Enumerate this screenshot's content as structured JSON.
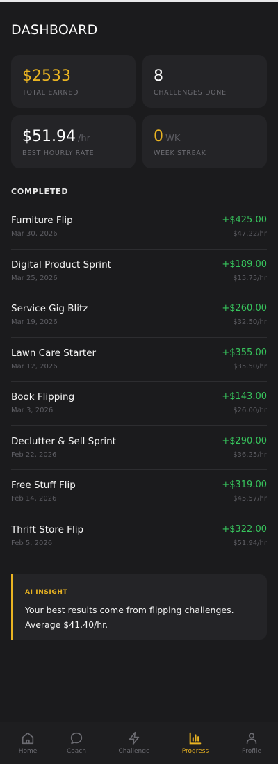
{
  "header": {
    "title": "DASHBOARD"
  },
  "stats": {
    "total_earned": {
      "value": "$2533",
      "label": "TOTAL EARNED"
    },
    "challenges_done": {
      "value": "8",
      "label": "CHALLENGES DONE"
    },
    "best_hourly_rate": {
      "value": "$51.94",
      "unit": "/hr",
      "label": "BEST HOURLY RATE"
    },
    "week_streak": {
      "value": "0",
      "unit": "WK",
      "label": "WEEK STREAK"
    }
  },
  "completed": {
    "title": "COMPLETED",
    "items": [
      {
        "name": "Furniture Flip",
        "date": "Mar 30, 2026",
        "amount": "+$425.00",
        "rate": "$47.22/hr"
      },
      {
        "name": "Digital Product Sprint",
        "date": "Mar 25, 2026",
        "amount": "+$189.00",
        "rate": "$15.75/hr"
      },
      {
        "name": "Service Gig Blitz",
        "date": "Mar 19, 2026",
        "amount": "+$260.00",
        "rate": "$32.50/hr"
      },
      {
        "name": "Lawn Care Starter",
        "date": "Mar 12, 2026",
        "amount": "+$355.00",
        "rate": "$35.50/hr"
      },
      {
        "name": "Book Flipping",
        "date": "Mar 3, 2026",
        "amount": "+$143.00",
        "rate": "$26.00/hr"
      },
      {
        "name": "Declutter & Sell Sprint",
        "date": "Feb 22, 2026",
        "amount": "+$290.00",
        "rate": "$36.25/hr"
      },
      {
        "name": "Free Stuff Flip",
        "date": "Feb 14, 2026",
        "amount": "+$319.00",
        "rate": "$45.57/hr"
      },
      {
        "name": "Thrift Store Flip",
        "date": "Feb 5, 2026",
        "amount": "+$322.00",
        "rate": "$51.94/hr"
      }
    ]
  },
  "insight": {
    "tag": "AI INSIGHT",
    "text": "Your best results come from flipping challenges. Average $41.40/hr."
  },
  "tabbar": {
    "active": "Progress",
    "tabs": [
      {
        "label": "Home",
        "icon": "home-icon"
      },
      {
        "label": "Coach",
        "icon": "chat-bubble-icon"
      },
      {
        "label": "Challenge",
        "icon": "lightning-icon"
      },
      {
        "label": "Progress",
        "icon": "bar-chart-icon"
      },
      {
        "label": "Profile",
        "icon": "user-icon"
      }
    ]
  },
  "colors": {
    "background": "#1b1b1d",
    "card": "#242427",
    "accent": "#eab422",
    "positive": "#37c35c",
    "muted": "#6c6c72"
  }
}
